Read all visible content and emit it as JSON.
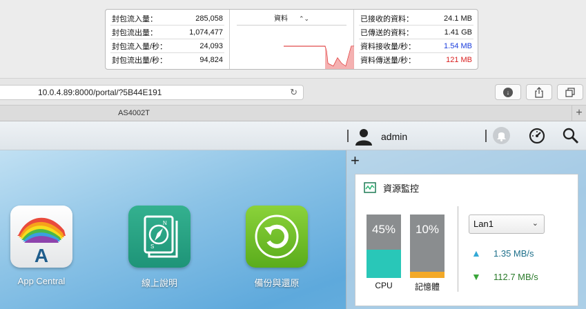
{
  "activity_monitor": {
    "left_stats": [
      {
        "label": "封包流入量：",
        "value": "285,058"
      },
      {
        "label": "封包流出量：",
        "value": "1,074,477"
      },
      {
        "label": "封包流入量/秒：",
        "value": "24,093"
      },
      {
        "label": "封包流出量/秒：",
        "value": "94,824"
      }
    ],
    "graph_title": "資料",
    "graph_chevron": "⌃⌄",
    "right_stats": [
      {
        "label": "已接收的資料：",
        "value": "24.1 MB"
      },
      {
        "label": "已傳送的資料：",
        "value": "1.41 GB"
      },
      {
        "label": "資料接收量/秒：",
        "value": "1.54 MB"
      },
      {
        "label": "資料傳送量/秒：",
        "value": "121 MB"
      }
    ],
    "colors": {
      "received": "#1a3cdc",
      "sent": "#d91e1e"
    }
  },
  "browser": {
    "url": "10.0.4.89:8000/portal/?5B44E191",
    "reload_icon": "reload-icon",
    "tab_title": "AS4002T",
    "new_tab": "+"
  },
  "adm": {
    "user": "admin",
    "apps": [
      {
        "label": "App Central"
      },
      {
        "label": "線上說明"
      },
      {
        "label": "備份與還原"
      }
    ],
    "widget": {
      "add": "+",
      "title": "資源監控",
      "cpu": {
        "label": "CPU",
        "percent_text": "45%",
        "level": 0.45,
        "color": "#29c7b8"
      },
      "memory": {
        "label": "記憶體",
        "percent_text": "10%",
        "level": 0.1,
        "color": "#f3a928"
      },
      "network_select": "Lan1",
      "upload_rate": "1.35 MB/s",
      "download_rate": "112.7 MB/s"
    }
  }
}
